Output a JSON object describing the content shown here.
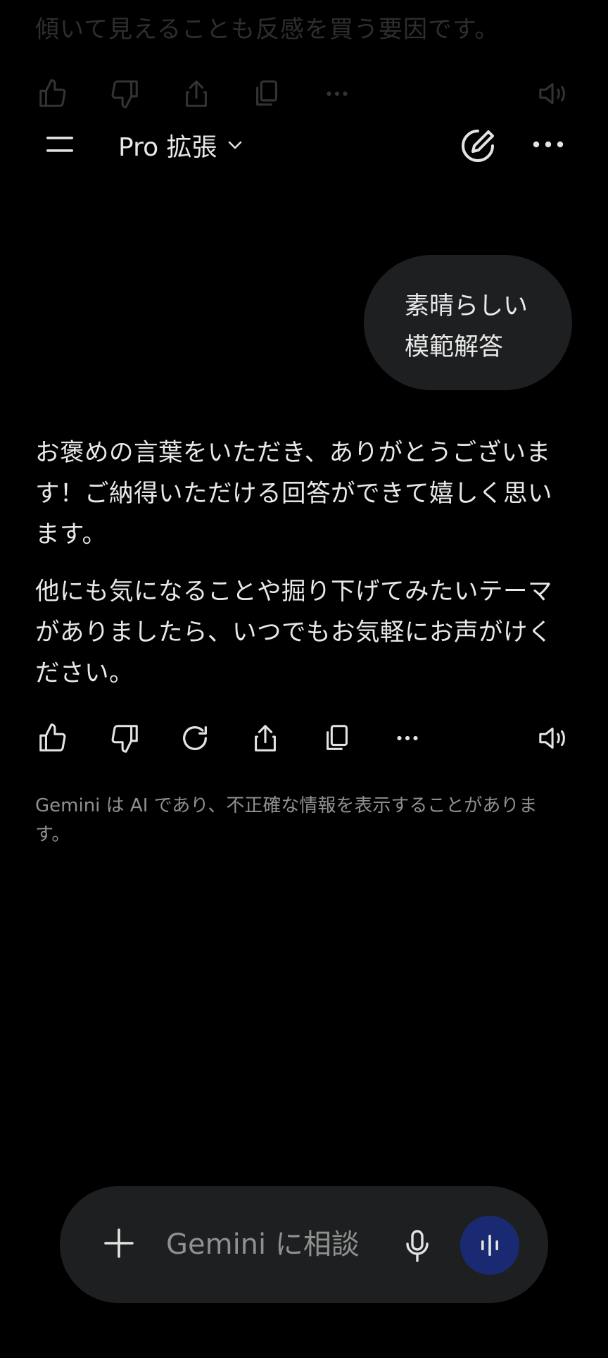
{
  "previous": {
    "text": "傾いて見えることも反感を買う要因です。"
  },
  "header": {
    "model_label": "Pro 拡張",
    "icons": [
      "menu-icon",
      "chevron-down-icon",
      "new-chat-icon",
      "more-icon"
    ]
  },
  "user_message": {
    "lines": [
      "素晴らしい",
      "模範解答"
    ]
  },
  "response": {
    "paragraph1": [
      "お褒めの言葉をいただき、ありがとうございま",
      "す！ご納得いただける回答ができて嬉しく思い",
      "ます。"
    ],
    "paragraph2": [
      "他にも気になることや掘り下げてみたいテーマ",
      "がありましたら、いつでもお気軽にお声がけく",
      "ださい。"
    ]
  },
  "response_actions": [
    "thumb-up-icon",
    "thumb-down-icon",
    "regenerate-icon",
    "share-icon",
    "copy-icon",
    "more-icon",
    "speaker-icon"
  ],
  "disclaimer": {
    "lines": [
      "Gemini は AI であり、不正確な情報を表示することがありま",
      "す。"
    ]
  },
  "composer": {
    "placeholder": "Gemini に相談",
    "icons": [
      "plus-icon",
      "microphone-icon",
      "live-waveform-icon"
    ]
  },
  "colors": {
    "background": "#000000",
    "surface": "#1e1f20",
    "text": "#e3e3e3",
    "muted": "#8e918f",
    "live_button": "#1a2a72"
  }
}
